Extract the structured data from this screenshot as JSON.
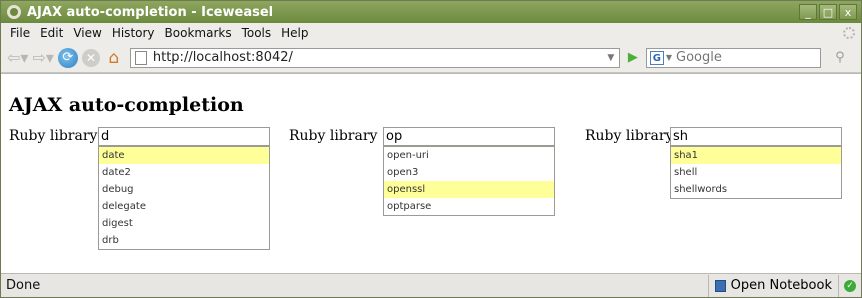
{
  "window": {
    "title": "AJAX auto-completion - Iceweasel",
    "minimize": "_",
    "maximize": "□",
    "close": "x"
  },
  "menu": [
    "File",
    "Edit",
    "View",
    "History",
    "Bookmarks",
    "Tools",
    "Help"
  ],
  "nav": {
    "url": "http://localhost:8042/",
    "search_placeholder": "Google",
    "icons": [
      "back-icon",
      "forward-icon",
      "reload-icon",
      "stop-icon",
      "home-icon",
      "go-icon",
      "search-icon"
    ]
  },
  "page": {
    "heading": "AJAX auto-completion",
    "fields": [
      {
        "label": "Ruby library",
        "value": "d",
        "suggestions": [
          "date",
          "date2",
          "debug",
          "delegate",
          "digest",
          "drb"
        ],
        "selected_index": 0
      },
      {
        "label": "Ruby library",
        "value": "op",
        "suggestions": [
          "open-uri",
          "open3",
          "openssl",
          "optparse"
        ],
        "selected_index": 2
      },
      {
        "label": "Ruby library",
        "value": "sh",
        "suggestions": [
          "sha1",
          "shell",
          "shellwords"
        ],
        "selected_index": 0
      }
    ]
  },
  "status": {
    "text": "Done",
    "notebook": "Open Notebook"
  },
  "colors": {
    "titlebar": "#6c8a3e",
    "highlight": "#ffff99"
  }
}
